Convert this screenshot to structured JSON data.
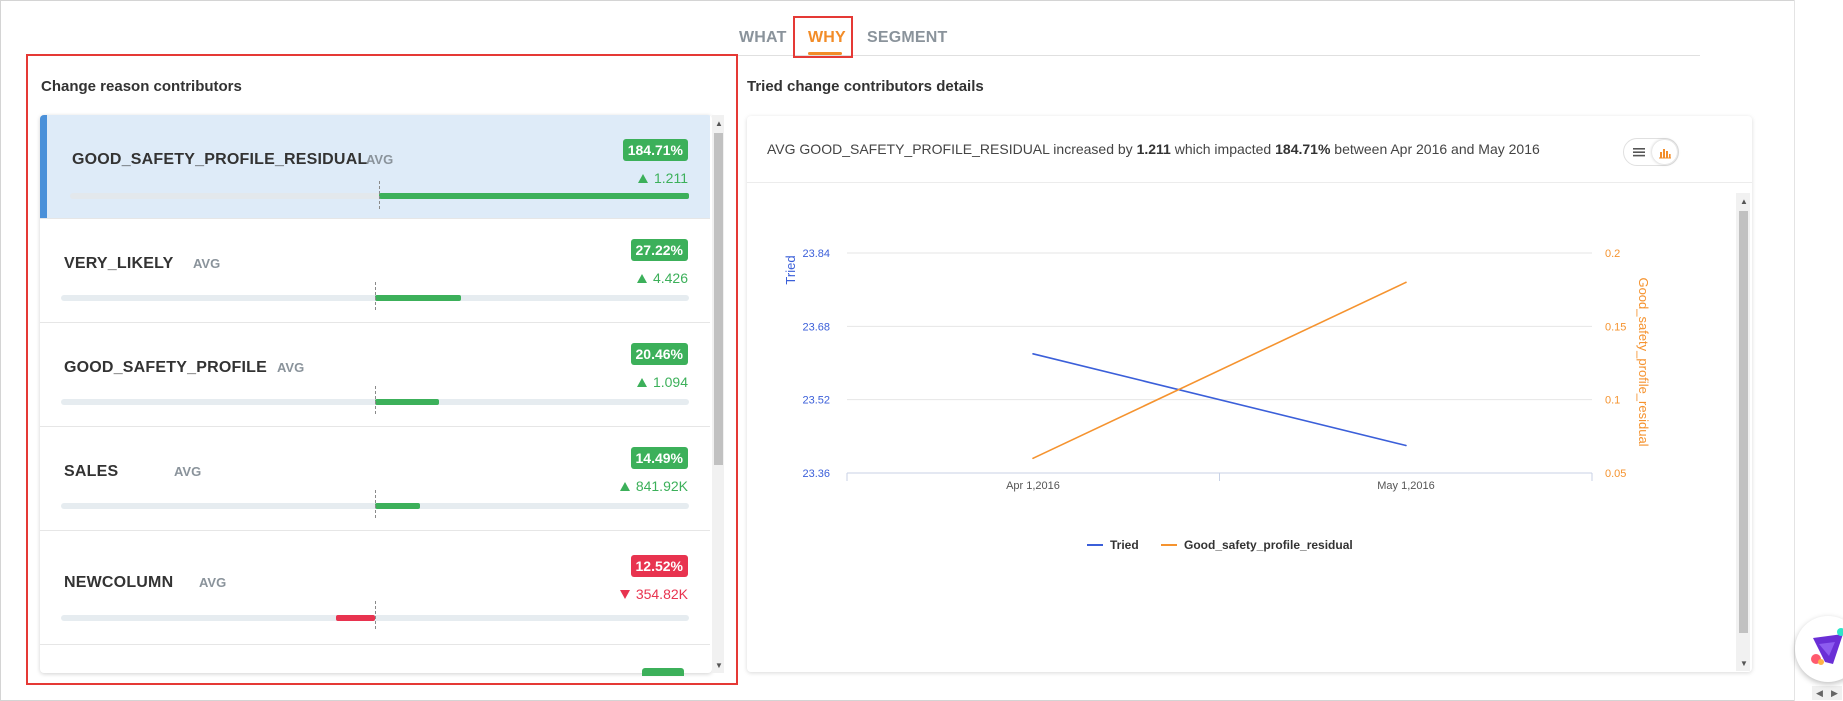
{
  "tabs": [
    {
      "label": "WHAT",
      "active": false
    },
    {
      "label": "WHY",
      "active": true
    },
    {
      "label": "SEGMENT",
      "active": false
    }
  ],
  "left_panel": {
    "title": "Change reason contributors",
    "items": [
      {
        "name": "GOOD_SAFETY_PROFILE_RESIDUAL",
        "aggregation": "AVG",
        "impact": "184.71%",
        "delta": "1.211",
        "direction": "up",
        "selected": true,
        "bar_fraction": 1.0
      },
      {
        "name": "VERY_LIKELY",
        "aggregation": "AVG",
        "impact": "27.22%",
        "delta": "4.426",
        "direction": "up",
        "selected": false,
        "bar_fraction": 0.27
      },
      {
        "name": "GOOD_SAFETY_PROFILE",
        "aggregation": "AVG",
        "impact": "20.46%",
        "delta": "1.094",
        "direction": "up",
        "selected": false,
        "bar_fraction": 0.2
      },
      {
        "name": "SALES",
        "aggregation": "AVG",
        "impact": "14.49%",
        "delta": "841.92K",
        "direction": "up",
        "selected": false,
        "bar_fraction": 0.14
      },
      {
        "name": "NEWCOLUMN",
        "aggregation": "AVG",
        "impact": "12.52%",
        "delta": "354.82K",
        "direction": "down",
        "selected": false,
        "bar_fraction": 0.12
      }
    ]
  },
  "right_panel": {
    "title": "Tried change contributors details",
    "summary": {
      "prefix": "AVG GOOD_SAFETY_PROFILE_RESIDUAL increased by ",
      "change": "1.211",
      "middle": " which impacted ",
      "impact": "184.71%",
      "suffix": " between Apr 2016 and May 2016"
    },
    "view_toggle": {
      "options": [
        "list-icon",
        "bar-chart-icon"
      ],
      "selected": "bar-chart-icon"
    }
  },
  "chart_data": {
    "type": "line",
    "categories": [
      "Apr 1,2016",
      "May 1,2016"
    ],
    "ylabel": "Tried",
    "ylabel_right": "Good_safety_profile_residual",
    "ylim": [
      23.36,
      23.84
    ],
    "yticks": [
      "23.36",
      "23.52",
      "23.68",
      "23.84"
    ],
    "ylim_right": [
      0.05,
      0.2
    ],
    "yticks_right": [
      "0.05",
      "0.1",
      "0.15",
      "0.2"
    ],
    "grid": true,
    "legend_position": "bottom",
    "series": [
      {
        "name": "Tried",
        "axis": "left",
        "color": "#3b5fd9",
        "values": [
          23.62,
          23.42
        ]
      },
      {
        "name": "Good_safety_profile_residual",
        "axis": "right",
        "color": "#f5932f",
        "values": [
          0.06,
          0.18
        ]
      }
    ]
  },
  "colors": {
    "accent": "#f28c28",
    "positive": "#3cb05a",
    "negative": "#e8334f",
    "selection": "#deebf8",
    "highlight": "#e53935"
  }
}
